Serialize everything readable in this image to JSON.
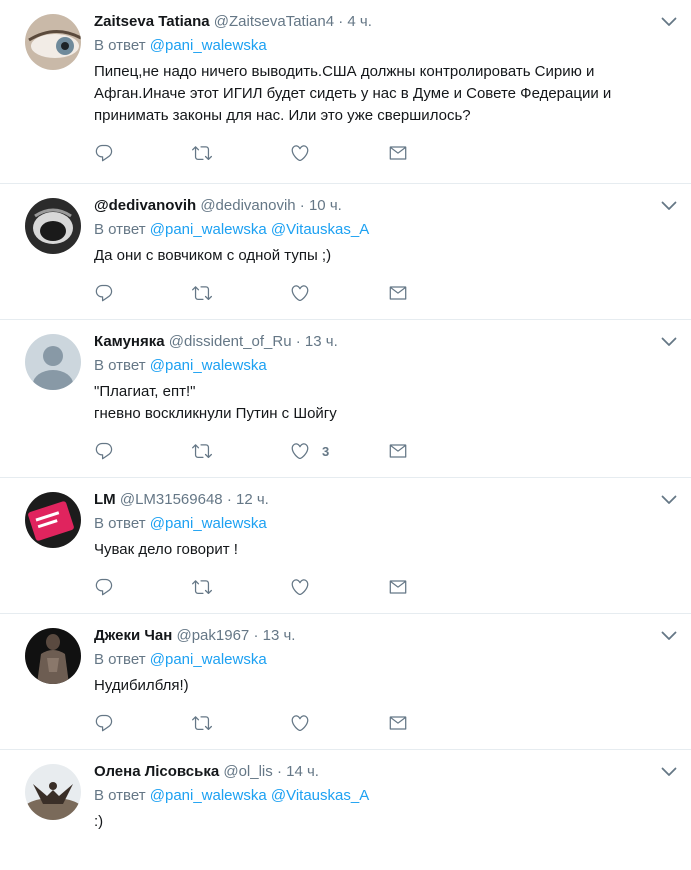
{
  "colors": {
    "link": "#1da1f2",
    "muted": "#657786",
    "text": "#14171a",
    "border": "#e6ecf0"
  },
  "icons": {
    "reply": "reply-icon",
    "retweet": "retweet-icon",
    "like": "heart-icon",
    "dm": "envelope-icon",
    "menu": "chevron-down-icon"
  },
  "tweets": [
    {
      "name": "Zaitseva Tatiana",
      "handle": "@ZaitsevaTatian4",
      "sep": "·",
      "time": "4 ч.",
      "reply_prefix": "В ответ",
      "reply_to": "@pani_walewska",
      "reply_to2": "",
      "lines": [
        "Пипец,не надо ничего выводить.США должны контролировать Сирию и",
        "Афган.Иначе этот ИГИЛ будет сидеть у нас в Думе и Совете Федерации и",
        "принимать законы для нас. Или это уже свершилось?"
      ],
      "likes": ""
    },
    {
      "name": "@dedivanovih",
      "handle": "@dedivanovih",
      "sep": "·",
      "time": "10 ч.",
      "reply_prefix": "В ответ",
      "reply_to": "@pani_walewska",
      "reply_to2": "@Vitauskas_A",
      "lines": [
        "Да они с вовчиком с одной тупы ;)",
        "",
        ""
      ],
      "likes": ""
    },
    {
      "name": "Камуняка",
      "handle": "@dissident_of_Ru",
      "sep": "·",
      "time": "13 ч.",
      "reply_prefix": "В ответ",
      "reply_to": "@pani_walewska",
      "reply_to2": "",
      "lines": [
        "\"Плагиат, епт!\"",
        "гневно воскликнули Путин с Шойгу",
        ""
      ],
      "likes": "3"
    },
    {
      "name": "LM",
      "handle": "@LM31569648",
      "sep": "·",
      "time": "12 ч.",
      "reply_prefix": "В ответ",
      "reply_to": "@pani_walewska",
      "reply_to2": "",
      "lines": [
        "Чувак дело говорит !",
        "",
        ""
      ],
      "likes": ""
    },
    {
      "name": "Джеки Чан",
      "handle": "@pak1967",
      "sep": "·",
      "time": "13 ч.",
      "reply_prefix": "В ответ",
      "reply_to": "@pani_walewska",
      "reply_to2": "",
      "lines": [
        "Нудибилбля!)",
        "",
        ""
      ],
      "likes": ""
    },
    {
      "name": "Олена Лісовська",
      "handle": "@ol_lis",
      "sep": "·",
      "time": "14 ч.",
      "reply_prefix": "В ответ",
      "reply_to": "@pani_walewska",
      "reply_to2": "@Vitauskas_A",
      "lines": [
        ":)",
        "",
        ""
      ],
      "likes": ""
    }
  ]
}
